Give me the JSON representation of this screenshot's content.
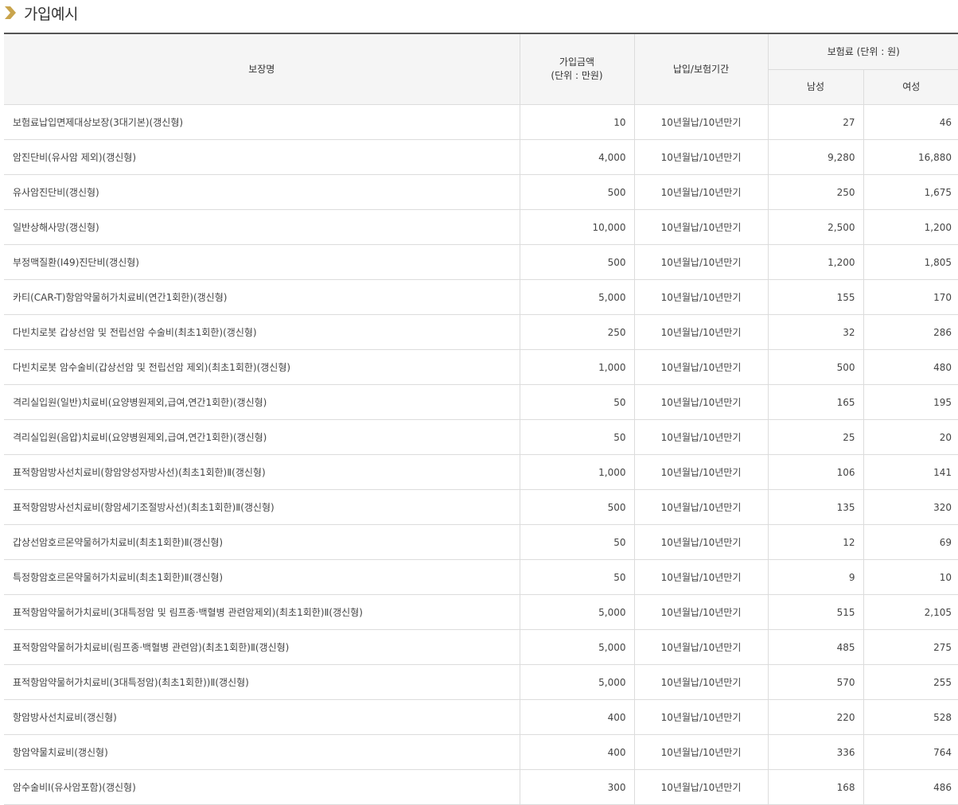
{
  "section": {
    "title": "가입예시",
    "icon": "chevron-right-icon",
    "icon_color": "#c9a44c"
  },
  "table": {
    "headers": {
      "name": "보장명",
      "amount_line1": "가입금액",
      "amount_line2": "(단위 : 만원)",
      "term": "납입/보험기간",
      "premium": "보험료 (단위 : 원)",
      "male": "남성",
      "female": "여성"
    },
    "rows": [
      {
        "name": "보험료납입면제대상보장(3대기본)(갱신형)",
        "amount": "10",
        "term": "10년월납/10년만기",
        "male": "27",
        "female": "46"
      },
      {
        "name": "암진단비(유사암 제외)(갱신형)",
        "amount": "4,000",
        "term": "10년월납/10년만기",
        "male": "9,280",
        "female": "16,880"
      },
      {
        "name": "유사암진단비(갱신형)",
        "amount": "500",
        "term": "10년월납/10년만기",
        "male": "250",
        "female": "1,675"
      },
      {
        "name": "일반상해사망(갱신형)",
        "amount": "10,000",
        "term": "10년월납/10년만기",
        "male": "2,500",
        "female": "1,200"
      },
      {
        "name": "부정맥질환(I49)진단비(갱신형)",
        "amount": "500",
        "term": "10년월납/10년만기",
        "male": "1,200",
        "female": "1,805"
      },
      {
        "name": "카티(CAR-T)항암약물허가치료비(연간1회한)(갱신형)",
        "amount": "5,000",
        "term": "10년월납/10년만기",
        "male": "155",
        "female": "170"
      },
      {
        "name": "다빈치로봇 갑상선암 및 전립선암 수술비(최초1회한)(갱신형)",
        "amount": "250",
        "term": "10년월납/10년만기",
        "male": "32",
        "female": "286"
      },
      {
        "name": "다빈치로봇 암수술비(갑상선암 및 전립선암 제외)(최초1회한)(갱신형)",
        "amount": "1,000",
        "term": "10년월납/10년만기",
        "male": "500",
        "female": "480"
      },
      {
        "name": "격리실입원(일반)치료비(요양병원제외,급여,연간1회한)(갱신형)",
        "amount": "50",
        "term": "10년월납/10년만기",
        "male": "165",
        "female": "195"
      },
      {
        "name": "격리실입원(음압)치료비(요양병원제외,급여,연간1회한)(갱신형)",
        "amount": "50",
        "term": "10년월납/10년만기",
        "male": "25",
        "female": "20"
      },
      {
        "name": "표적항암방사선치료비(항암양성자방사선)(최초1회한)Ⅱ(갱신형)",
        "amount": "1,000",
        "term": "10년월납/10년만기",
        "male": "106",
        "female": "141"
      },
      {
        "name": "표적항암방사선치료비(항암세기조절방사선)(최초1회한)Ⅱ(갱신형)",
        "amount": "500",
        "term": "10년월납/10년만기",
        "male": "135",
        "female": "320"
      },
      {
        "name": "갑상선암호르몬약물허가치료비(최초1회한)Ⅱ(갱신형)",
        "amount": "50",
        "term": "10년월납/10년만기",
        "male": "12",
        "female": "69"
      },
      {
        "name": "특정항암호르몬약물허가치료비(최초1회한)Ⅱ(갱신형)",
        "amount": "50",
        "term": "10년월납/10년만기",
        "male": "9",
        "female": "10"
      },
      {
        "name": "표적항암약물허가치료비(3대특정암 및 림프종·백혈병 관련암제외)(최초1회한)Ⅱ(갱신형)",
        "amount": "5,000",
        "term": "10년월납/10년만기",
        "male": "515",
        "female": "2,105"
      },
      {
        "name": "표적항암약물허가치료비(림프종·백혈병 관련암)(최초1회한)Ⅱ(갱신형)",
        "amount": "5,000",
        "term": "10년월납/10년만기",
        "male": "485",
        "female": "275"
      },
      {
        "name": "표적항암약물허가치료비(3대특정암)(최초1회한))Ⅱ(갱신형)",
        "amount": "5,000",
        "term": "10년월납/10년만기",
        "male": "570",
        "female": "255"
      },
      {
        "name": "항암방사선치료비(갱신형)",
        "amount": "400",
        "term": "10년월납/10년만기",
        "male": "220",
        "female": "528"
      },
      {
        "name": "항암약물치료비(갱신형)",
        "amount": "400",
        "term": "10년월납/10년만기",
        "male": "336",
        "female": "764"
      },
      {
        "name": "암수술비Ⅰ(유사암포함)(갱신형)",
        "amount": "300",
        "term": "10년월납/10년만기",
        "male": "168",
        "female": "486"
      }
    ]
  }
}
